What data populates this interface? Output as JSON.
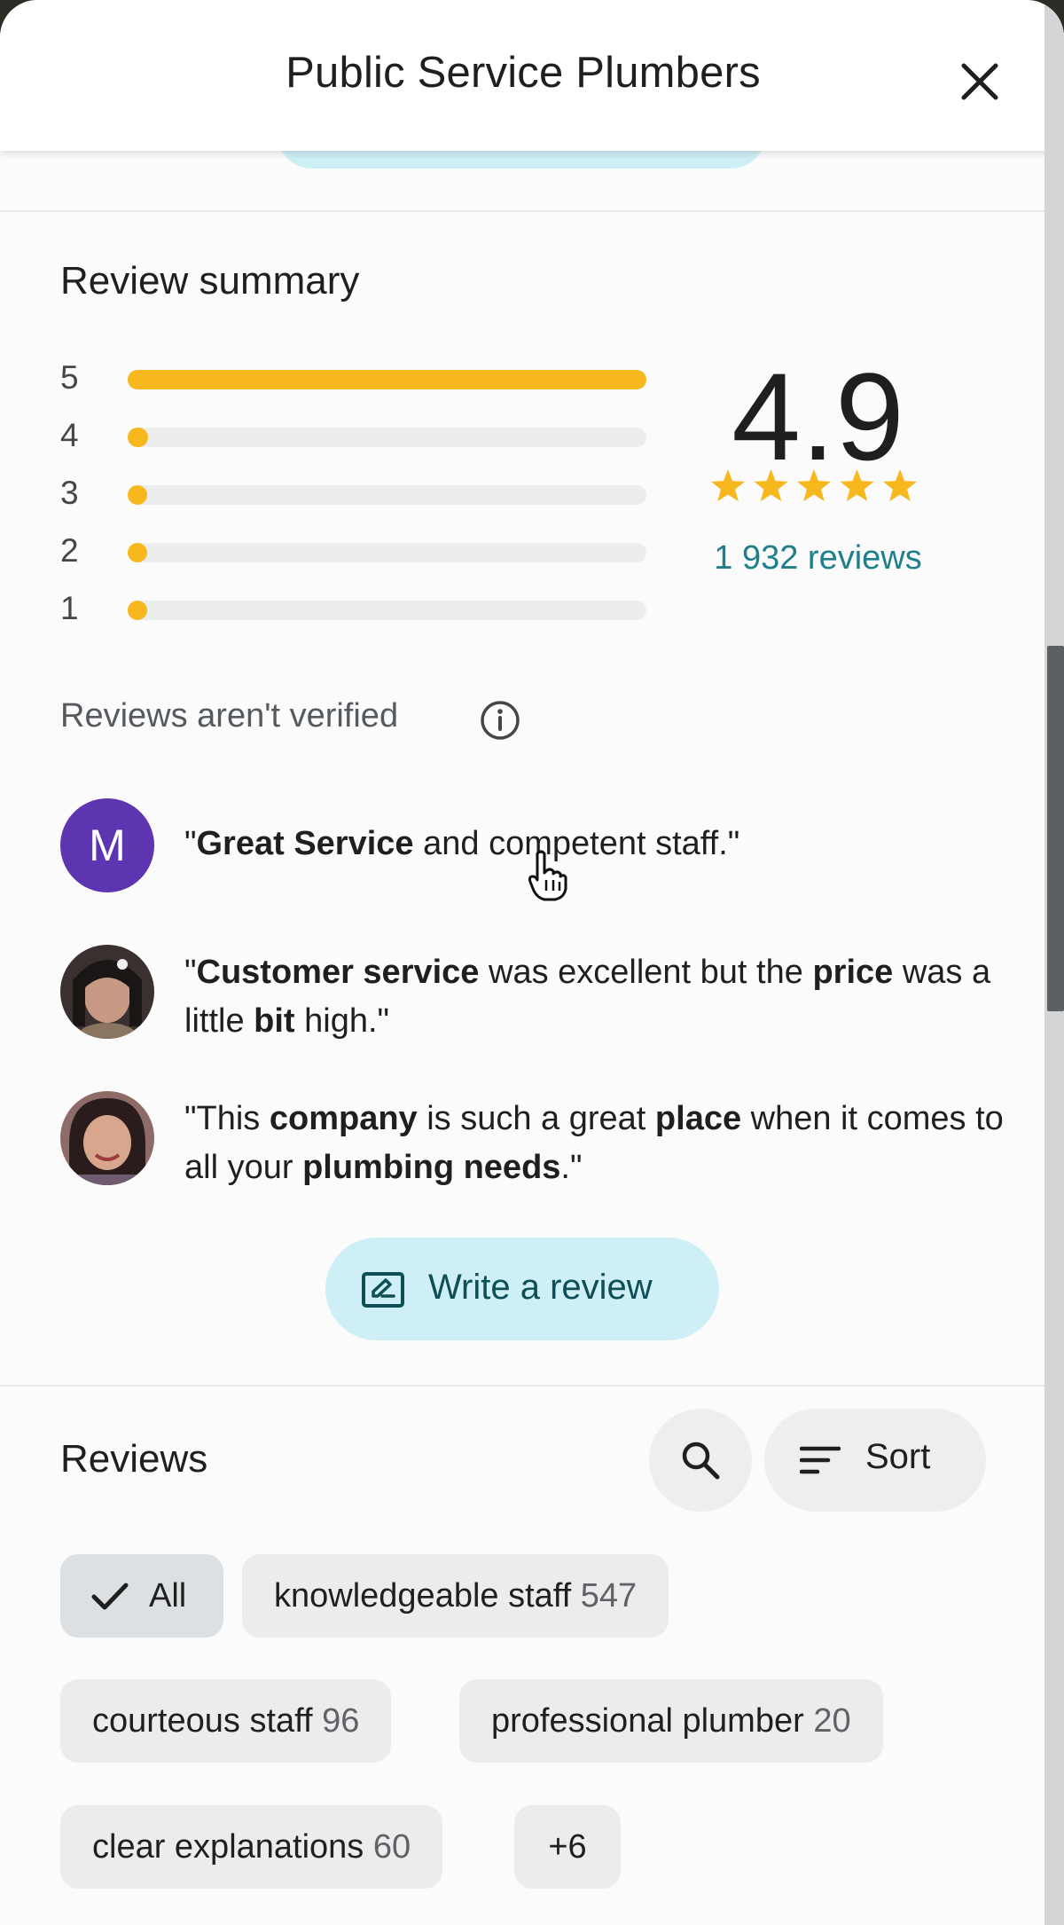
{
  "header": {
    "title": "Public Service Plumbers",
    "close_icon": "close-icon"
  },
  "summary": {
    "title": "Review summary",
    "distribution": [
      {
        "stars": "5",
        "fraction": 1.0
      },
      {
        "stars": "4",
        "fraction": 0.04
      },
      {
        "stars": "3",
        "fraction": 0.015
      },
      {
        "stars": "2",
        "fraction": 0.015
      },
      {
        "stars": "1",
        "fraction": 0.035
      }
    ],
    "rating": "4.9",
    "stars_filled": 5,
    "review_count": "1 932 reviews",
    "unverified": "Reviews aren't verified",
    "star_color": "#f6b81d"
  },
  "snippets": [
    {
      "avatar_letter": "M",
      "segments": [
        {
          "text": "\"",
          "bold": false
        },
        {
          "text": "Great Service",
          "bold": true
        },
        {
          "text": " and competent staff.\"",
          "bold": false
        }
      ]
    },
    {
      "avatar_letter": "",
      "segments": [
        {
          "text": "\"",
          "bold": false
        },
        {
          "text": "Customer service",
          "bold": true
        },
        {
          "text": " was excellent but the ",
          "bold": false
        },
        {
          "text": "price",
          "bold": true
        },
        {
          "text": " was a little ",
          "bold": false
        },
        {
          "text": "bit",
          "bold": true
        },
        {
          "text": " high.\"",
          "bold": false
        }
      ]
    },
    {
      "avatar_letter": "",
      "segments": [
        {
          "text": "\"This ",
          "bold": false
        },
        {
          "text": "company",
          "bold": true
        },
        {
          "text": " is such a great ",
          "bold": false
        },
        {
          "text": "place",
          "bold": true
        },
        {
          "text": " when it comes to all your ",
          "bold": false
        },
        {
          "text": "plumbing needs",
          "bold": true
        },
        {
          "text": ".\"",
          "bold": false
        }
      ]
    }
  ],
  "write_review": {
    "label": "Write a review"
  },
  "reviews": {
    "title": "Reviews",
    "sort_label": "Sort",
    "chips": [
      {
        "label": "All",
        "count": "",
        "selected": true
      },
      {
        "label": "knowledgeable staff",
        "count": "547",
        "selected": false
      },
      {
        "label": "courteous staff",
        "count": "96",
        "selected": false
      },
      {
        "label": "professional plumber",
        "count": "20",
        "selected": false
      },
      {
        "label": "clear explanations",
        "count": "60",
        "selected": false
      },
      {
        "label": "+6",
        "count": "",
        "selected": false
      }
    ]
  },
  "colors": {
    "accent": "#1f7f8a",
    "button_bg": "#cdeff5",
    "avatar_m": "#5e35b1"
  }
}
